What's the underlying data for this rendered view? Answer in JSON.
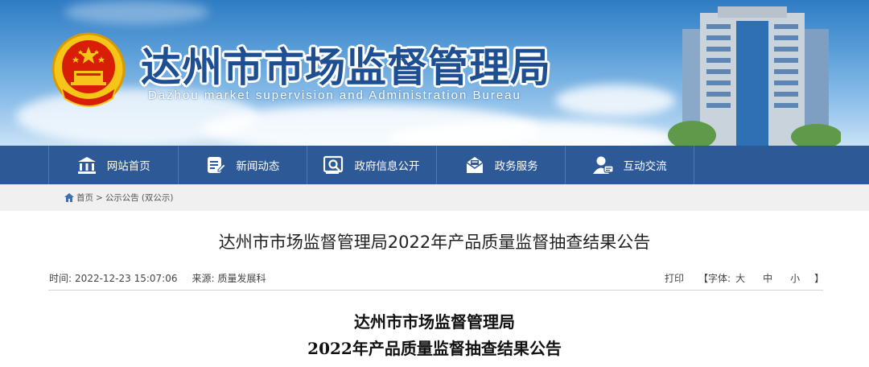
{
  "site": {
    "title_cn": "达州市市场监督管理局",
    "title_en": "Dazhou market supervision and Administration Bureau"
  },
  "nav": {
    "items": [
      {
        "label": "网站首页",
        "icon": "home-building-icon"
      },
      {
        "label": "新闻动态",
        "icon": "news-document-icon"
      },
      {
        "label": "政府信息公开",
        "icon": "info-disclosure-icon"
      },
      {
        "label": "政务服务",
        "icon": "service-envelope-icon"
      },
      {
        "label": "互动交流",
        "icon": "interaction-user-icon"
      }
    ]
  },
  "breadcrumb": {
    "home": "首页",
    "sep1": ">",
    "section": "公示公告",
    "sub": "(双公示)"
  },
  "article": {
    "title": "达州市市场监督管理局2022年产品质量监督抽查结果公告",
    "time_label": "时间:",
    "time_value": "2022-12-23 15:07:06",
    "source_label": "来源:",
    "source_value": "质量发展科",
    "print_label": "打印",
    "font_label": "【字体:",
    "font_large": "大",
    "font_medium": "中",
    "font_small": "小",
    "font_end": "】",
    "heading_line1": "达州市市场监督管理局",
    "heading_line2": "2022年产品质量监督抽查结果公告"
  },
  "colors": {
    "nav_bg": "#2d5a96",
    "title_blue": "#1d4f92",
    "crumb_bg": "#f0f0f0"
  }
}
